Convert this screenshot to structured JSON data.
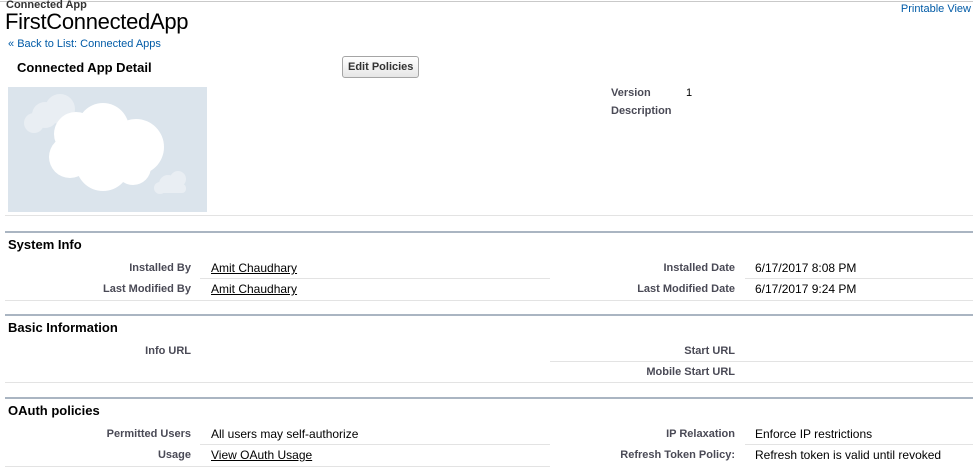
{
  "header": {
    "type_label": "Connected App",
    "app_name": "FirstConnectedApp",
    "printable_view": "Printable View",
    "back_chevron": "«",
    "back_link": "Back to List: Connected Apps"
  },
  "detail": {
    "title": "Connected App Detail",
    "edit_button": "Edit Policies",
    "logo_icon": "salesforce-cloud-logo",
    "version_label": "Version",
    "version_value": "1",
    "description_label": "Description"
  },
  "system_info": {
    "title": "System Info",
    "installed_by_label": "Installed By",
    "installed_by_value": "Amit Chaudhary",
    "installed_date_label": "Installed Date",
    "installed_date_value": "6/17/2017 8:08 PM",
    "last_modified_by_label": "Last Modified By",
    "last_modified_by_value": "Amit Chaudhary",
    "last_modified_date_label": "Last Modified Date",
    "last_modified_date_value": "6/17/2017 9:24 PM"
  },
  "basic_info": {
    "title": "Basic Information",
    "info_url_label": "Info URL",
    "start_url_label": "Start URL",
    "mobile_start_url_label": "Mobile Start URL"
  },
  "oauth": {
    "title": "OAuth policies",
    "permitted_users_label": "Permitted Users",
    "permitted_users_value": "All users may self-authorize",
    "ip_relaxation_label": "IP Relaxation",
    "ip_relaxation_value": "Enforce IP restrictions",
    "usage_label": "Usage",
    "usage_value": "View OAuth Usage",
    "refresh_token_label": "Refresh Token Policy:",
    "refresh_token_value": "Refresh token is valid until revoked"
  },
  "colors": {
    "link": "#015ba7",
    "section_rule": "#aab5c2",
    "logo_bg": "#dbe4ec"
  }
}
